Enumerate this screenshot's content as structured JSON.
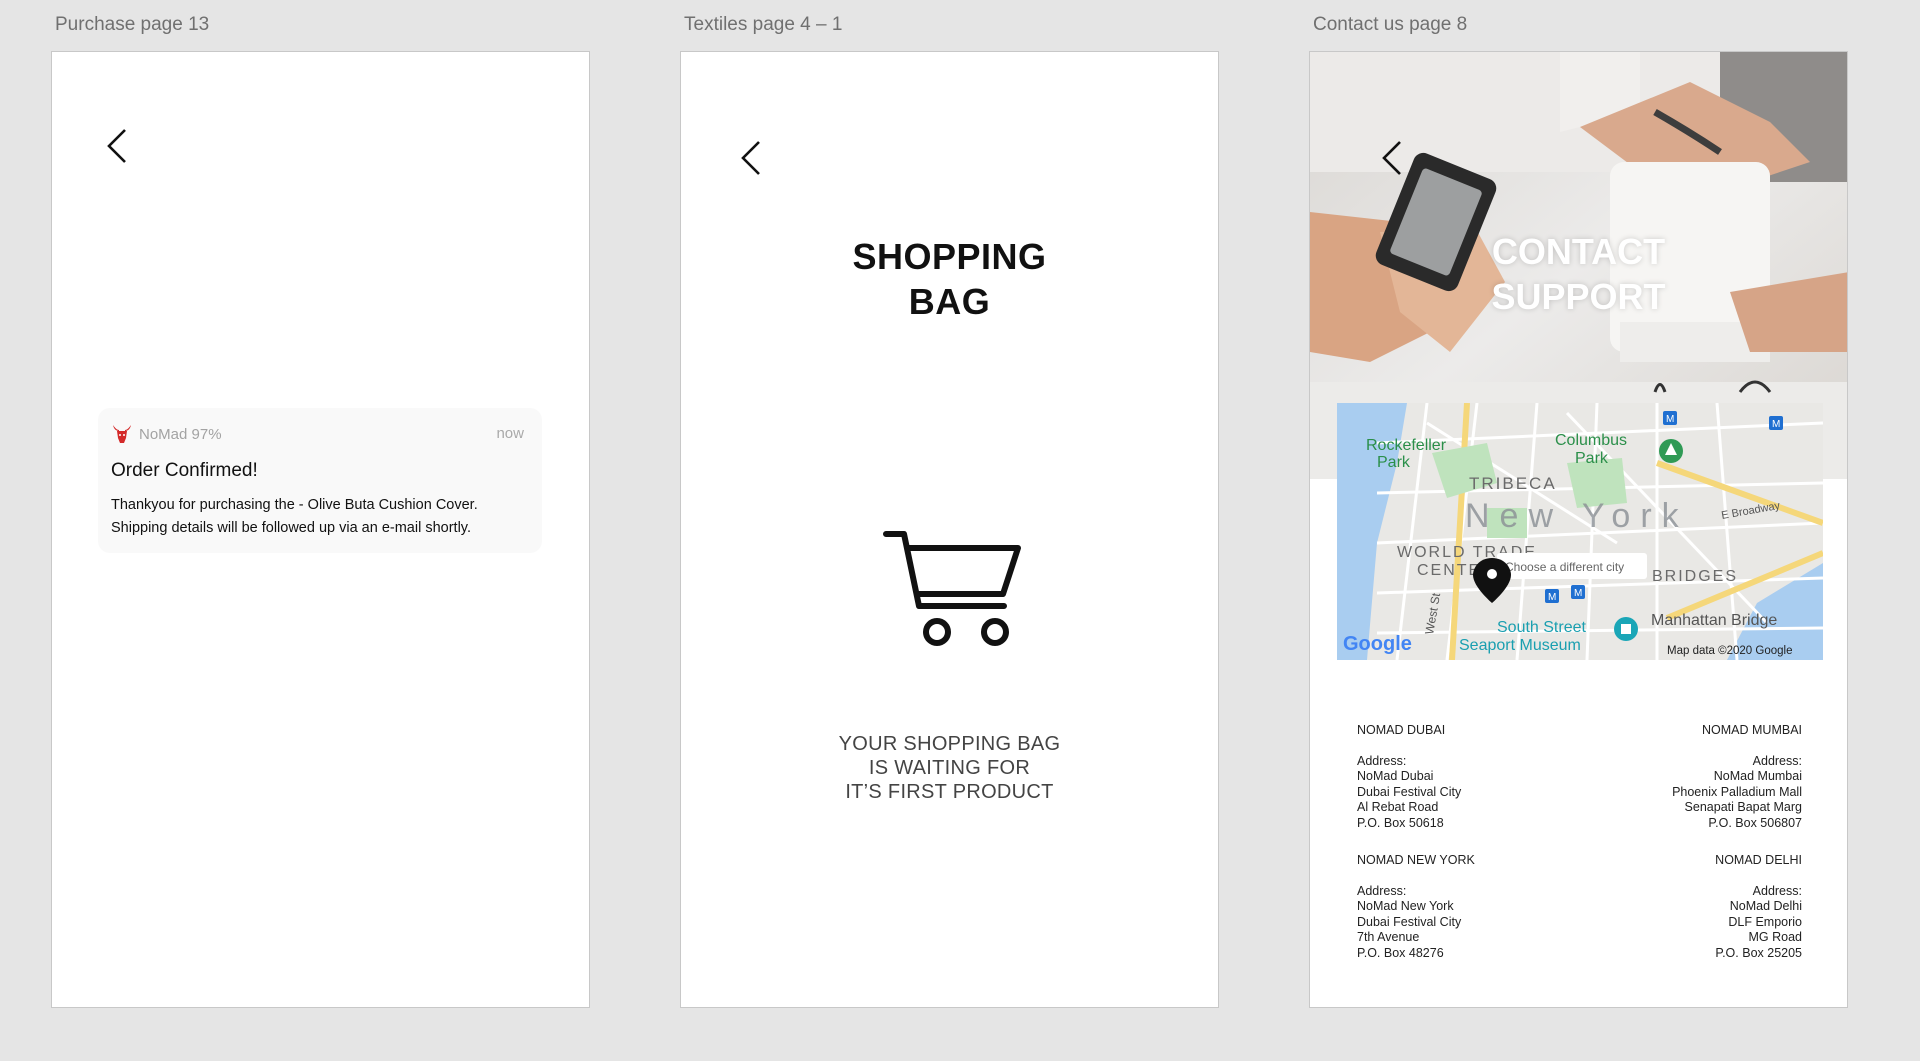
{
  "artboards": [
    {
      "label": "Purchase page 13"
    },
    {
      "label": "Textiles page 4 – 1"
    },
    {
      "label": "Contact us page 8"
    }
  ],
  "purchase": {
    "notification": {
      "app_name": "NoMad 97%",
      "time": "now",
      "title": "Order Confirmed!",
      "body_line1": "Thankyou for purchasing the - Olive Buta Cushion Cover.",
      "body_line2": "Shipping details will be followed up via an e-mail shortly."
    }
  },
  "shopping_bag": {
    "title_line1": "SHOPPING",
    "title_line2": "BAG",
    "message_line1": "YOUR SHOPPING BAG",
    "message_line2": "IS WAITING FOR",
    "message_line3": "IT’S FIRST PRODUCT"
  },
  "contact": {
    "title_line1": "CONTACT",
    "title_line2": "SUPPORT",
    "map": {
      "labels": {
        "rockefeller_1": "Rockefeller",
        "rockefeller_2": "Park",
        "columbus_1": "Columbus",
        "columbus_2": "Park",
        "tribeca": "TRIBECA",
        "new_york": "New York",
        "broadway": "E Broadway",
        "world_trade_1": "WORLD TRADE",
        "world_trade_2": "CENTER",
        "choose_city": "Choose a different city",
        "bridges": "BRIDGES",
        "west_st": "West St",
        "south_street_1": "South Street",
        "south_street_2": "Seaport Museum",
        "manhattan_bridge": "Manhattan Bridge",
        "google": "Google",
        "map_data": "Map data ©2020 Google"
      }
    },
    "offices": [
      {
        "name": "NOMAD DUBAI",
        "address_label": "Address:",
        "lines": [
          "NoMad Dubai",
          "Dubai Festival City",
          "Al Rebat Road",
          "P.O. Box 50618"
        ]
      },
      {
        "name": "NOMAD MUMBAI",
        "address_label": "Address:",
        "lines": [
          "NoMad Mumbai",
          "Phoenix Palladium Mall",
          "Senapati Bapat Marg",
          "P.O. Box 506807"
        ]
      },
      {
        "name": "NOMAD NEW YORK",
        "address_label": "Address:",
        "lines": [
          "NoMad New York",
          "Dubai Festival City",
          "7th Avenue",
          "P.O. Box 48276"
        ]
      },
      {
        "name": "NOMAD DELHI",
        "address_label": "Address:",
        "lines": [
          "NoMad Delhi",
          "DLF Emporio",
          "MG Road",
          "P.O. Box 25205"
        ]
      }
    ]
  },
  "icons": {
    "back": "chevron-left-icon",
    "cart": "shopping-cart-icon",
    "app": "bull-logo-icon",
    "pin": "map-pin-icon"
  },
  "colors": {
    "canvas": "#e5e5e5",
    "artboard": "#ffffff",
    "label": "#707070",
    "logo_red": "#d42a2a"
  }
}
